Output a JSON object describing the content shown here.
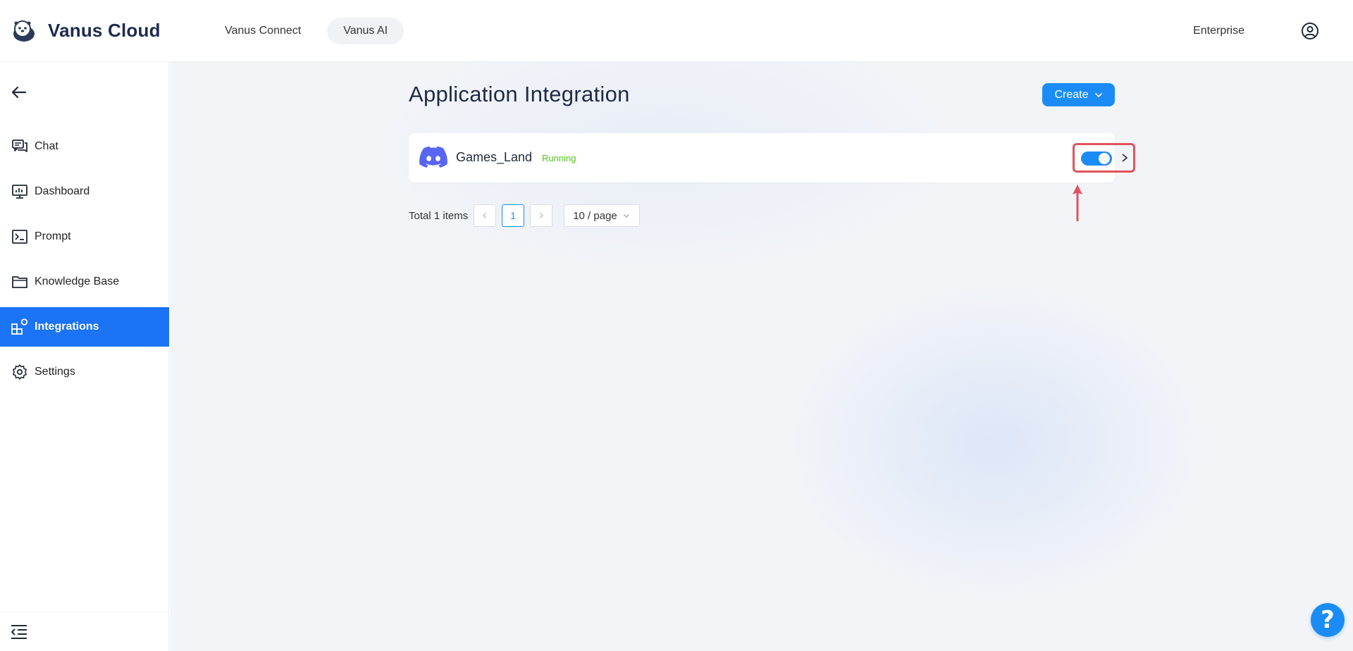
{
  "header": {
    "brand_name": "Vanus Cloud",
    "nav": [
      {
        "label": "Vanus Connect",
        "active": false
      },
      {
        "label": "Vanus AI",
        "active": true
      }
    ],
    "enterprise_label": "Enterprise",
    "user_icon": "user-circle-icon"
  },
  "sidebar": {
    "back_icon": "arrow-left-icon",
    "items": [
      {
        "label": "Chat",
        "icon": "chat-icon",
        "active": false
      },
      {
        "label": "Dashboard",
        "icon": "dashboard-icon",
        "active": false
      },
      {
        "label": "Prompt",
        "icon": "terminal-icon",
        "active": false
      },
      {
        "label": "Knowledge Base",
        "icon": "folder-icon",
        "active": false
      },
      {
        "label": "Integrations",
        "icon": "integrations-icon",
        "active": true
      },
      {
        "label": "Settings",
        "icon": "gear-icon",
        "active": false
      }
    ],
    "collapse_icon": "menu-collapse-icon"
  },
  "main": {
    "title": "Application Integration",
    "create_label": "Create",
    "integrations": [
      {
        "name": "Games_Land",
        "status": "Running",
        "platform_icon": "discord-icon",
        "enabled": true
      }
    ],
    "pagination": {
      "total_text": "Total 1 items",
      "current_page": "1",
      "page_size": "10 / page"
    }
  },
  "colors": {
    "accent": "#1b8cf5",
    "sidebar_active": "#1b73f5",
    "status_running": "#52c41a",
    "annotation": "#e0535b",
    "discord": "#5865f2"
  },
  "help_label": "?"
}
